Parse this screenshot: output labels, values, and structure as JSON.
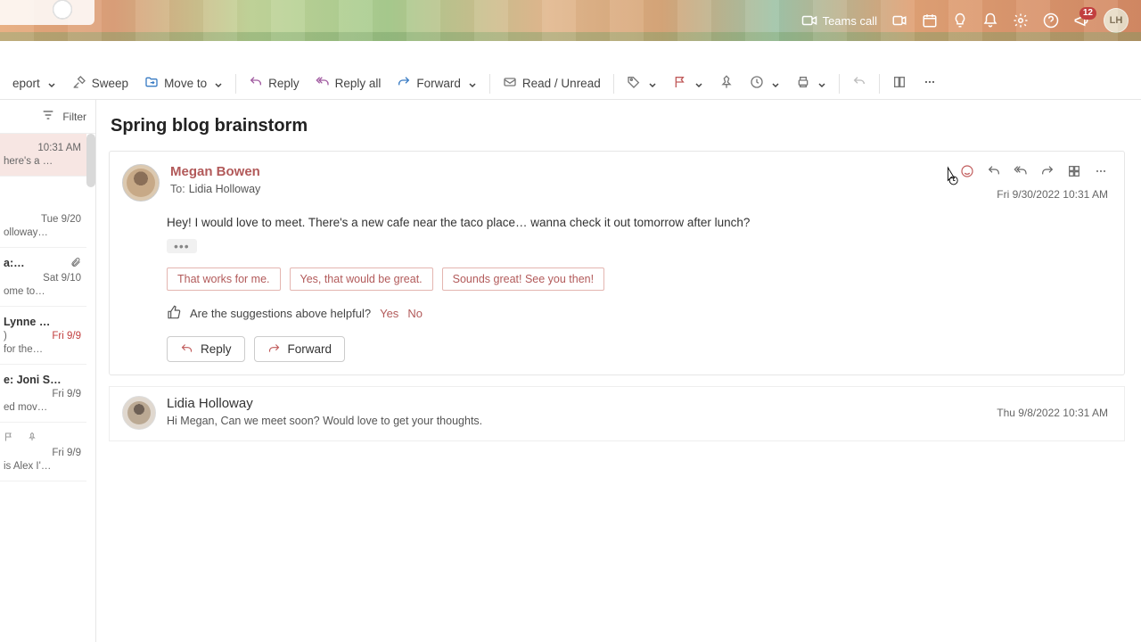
{
  "banner": {
    "teams_label": "Teams call",
    "badge": "12",
    "avatar_initials": "LH"
  },
  "toolbar": {
    "report": "eport",
    "sweep": "Sweep",
    "move": "Move to",
    "reply": "Reply",
    "reply_all": "Reply all",
    "forward": "Forward",
    "read": "Read / Unread"
  },
  "filter": {
    "label": "Filter"
  },
  "list": [
    {
      "time": "10:31 AM",
      "preview": "here's a …",
      "selected": true
    },
    {
      "time": "Tue 9/20",
      "preview": "olloway…"
    },
    {
      "name": "a:…",
      "time": "Sat 9/10",
      "preview": "ome to…",
      "attach": true
    },
    {
      "name": "Lynne …",
      "time": "Fri 9/9",
      "preview": "for the…",
      "time_red": true,
      "sub": ")"
    },
    {
      "name": "e: Joni S…",
      "time": "Fri 9/9",
      "preview": "ed mov…"
    },
    {
      "time": "Fri 9/9",
      "preview": "is Alex I'…",
      "flags": true
    }
  ],
  "thread": {
    "subject": "Spring blog brainstorm",
    "msg1": {
      "from": "Megan Bowen",
      "to_label": "To:",
      "to": "Lidia Holloway",
      "date": "Fri 9/30/2022 10:31 AM",
      "body": "Hey! I would love to meet. There's a new cafe near the taco place… wanna check it out tomorrow after lunch?",
      "suggestions": [
        "That works for me.",
        "Yes, that would be great.",
        "Sounds great! See you then!"
      ],
      "feedback": "Are the suggestions above helpful?",
      "yes": "Yes",
      "no": "No",
      "reply": "Reply",
      "forward": "Forward"
    },
    "msg2": {
      "from": "Lidia Holloway",
      "body": "Hi Megan, Can we meet soon? Would love to get your thoughts.",
      "date": "Thu 9/8/2022 10:31 AM"
    }
  }
}
